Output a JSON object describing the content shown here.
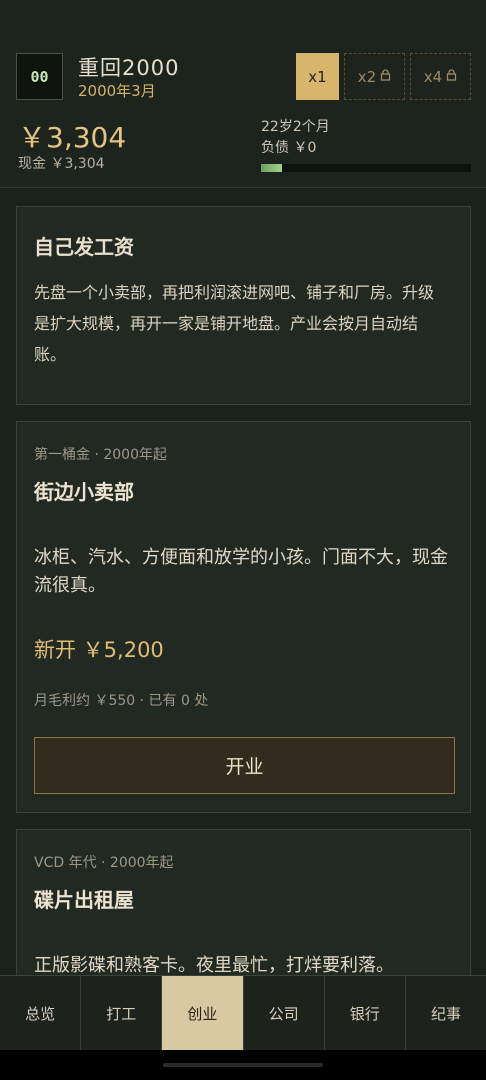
{
  "header": {
    "avatar_text": "00",
    "title": "重回2000",
    "date": "2000年3月",
    "speeds": [
      {
        "label": "x1",
        "locked": false,
        "active": true
      },
      {
        "label": "x2",
        "locked": true,
        "active": false
      },
      {
        "label": "x4",
        "locked": true,
        "active": false
      }
    ],
    "cash_big": "￥3,304",
    "cash_small": "现金 ￥3,304",
    "age": "22岁2个月",
    "debt": "负债 ￥0",
    "progress_fraction": 0.1,
    "lock_icon": "lock-icon"
  },
  "intro": {
    "title": "自己发工资",
    "body": "先盘一个小卖部，再把利润滚进网吧、铺子和厂房。升级是扩大规模，再开一家是铺开地盘。产业会按月自动结账。"
  },
  "businesses": [
    {
      "meta": "第一桶金 · 2000年起",
      "title": "街边小卖部",
      "desc": "冰柜、汽水、方便面和放学的小孩。门面不大，现金流很真。",
      "price": "新开 ￥5,200",
      "stats": "月毛利约 ￥550 · 已有 0 处",
      "button": "开业"
    },
    {
      "meta": "VCD 年代 · 2000年起",
      "title": "碟片出租屋",
      "desc": "正版影碟和熟客卡。夜里最忙，打烊要利落。"
    }
  ],
  "nav": [
    {
      "label": "总览",
      "active": false
    },
    {
      "label": "打工",
      "active": false
    },
    {
      "label": "创业",
      "active": true
    },
    {
      "label": "公司",
      "active": false
    },
    {
      "label": "银行",
      "active": false
    },
    {
      "label": "纪事",
      "active": false
    }
  ],
  "colors": {
    "accent_gold": "#d7b56d",
    "background": "#1b211c",
    "progress_green": "#a6d194"
  }
}
